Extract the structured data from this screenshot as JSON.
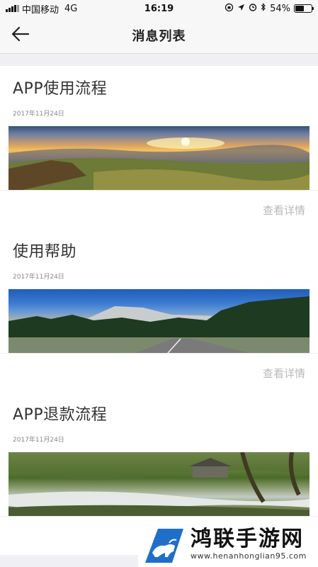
{
  "status_bar": {
    "carrier": "中国移动",
    "network": "4G",
    "time": "16:19",
    "battery": "54%",
    "battery_level": 0.54
  },
  "header": {
    "title": "消息列表",
    "back_icon": "arrow-left-icon"
  },
  "articles": [
    {
      "title": "APP使用流程",
      "date": "2017年11月24日",
      "image": "sunset-landscape",
      "detail_label": "查看详情"
    },
    {
      "title": "使用帮助",
      "date": "2017年11月24日",
      "image": "mountain-road",
      "detail_label": "查看详情"
    },
    {
      "title": "APP退款流程",
      "date": "2017年11月24日",
      "image": "forest-stream",
      "detail_label": ""
    }
  ],
  "watermark": {
    "title": "鸿联手游网",
    "url": "www.henanhonglian95.com"
  },
  "colors": {
    "background": "#efeff4",
    "card": "#ffffff",
    "link": "#b8b8b8"
  }
}
